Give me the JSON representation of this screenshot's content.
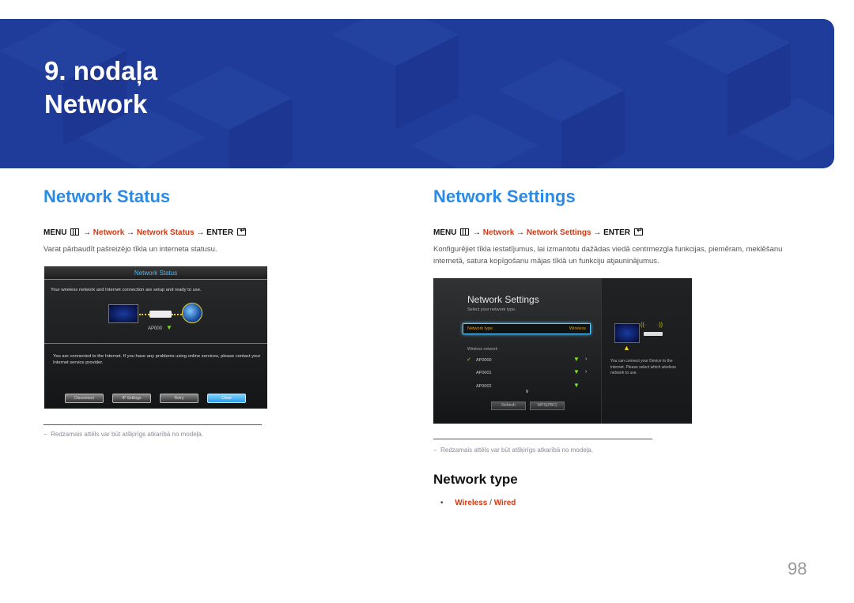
{
  "banner": {
    "chapter": "9. nodaļa",
    "title": "Network",
    "bg_color": "#1f3c9a"
  },
  "network_status": {
    "heading": "Network Status",
    "menu_path": {
      "menu": "MENU",
      "menu_icon": "menu-grid-icon",
      "arrow": "→",
      "step1": "Network",
      "step2": "Network Status",
      "enter": "ENTER",
      "enter_icon": "enter-icon"
    },
    "description": "Varat pārbaudīt pašreizējo tīkla un interneta statusu.",
    "screen": {
      "title": "Network Status",
      "message1": "Your wireless network and Internet connection are setup and ready to use.",
      "ap_name": "AP000",
      "message2": "You are connected to the Internet. If you have any problems using online services, please contact your Internet service provider.",
      "buttons": [
        "Disconnect",
        "IP Settings",
        "Retry",
        "Close"
      ],
      "active_button": "Close"
    },
    "note": "Redzamais attēls var būt atšķirīgs atkarībā no modeļa."
  },
  "network_settings": {
    "heading": "Network Settings",
    "menu_path": {
      "menu": "MENU",
      "menu_icon": "menu-grid-icon",
      "arrow": "→",
      "step1": "Network",
      "step2": "Network Settings",
      "enter": "ENTER",
      "enter_icon": "enter-icon"
    },
    "description": "Konfigurējiet tīkla iestatījumus, lai izmantotu dažādas viedā centrmezgla funkcijas, piemēram, meklēšanu internetā, satura kopīgošanu mājas tīklā un funkciju atjauninājumus.",
    "screen": {
      "title": "Network Settings",
      "subtitle": "Select your network type.",
      "network_type_label": "Network type",
      "network_type_value": "Wireless",
      "wireless_network_label": "Wireless network",
      "access_points": [
        {
          "name": "AP0000",
          "selected": true,
          "has_arrow": true
        },
        {
          "name": "AP0001",
          "selected": false,
          "has_arrow": true
        },
        {
          "name": "AP0002",
          "selected": false,
          "has_arrow": false
        }
      ],
      "buttons": [
        "Refresh",
        "WPS(PBC)"
      ],
      "side_text": "You can connect your Device to the internet. Please select which wireless network to use."
    },
    "note": "Redzamais attēls var būt atšķirīgs atkarībā no modeļa."
  },
  "network_type": {
    "heading": "Network type",
    "options": [
      "Wireless",
      "Wired"
    ],
    "separator": "/"
  },
  "page_number": "98",
  "colors": {
    "heading_blue": "#2a8ae8",
    "path_red": "#d03a16"
  }
}
